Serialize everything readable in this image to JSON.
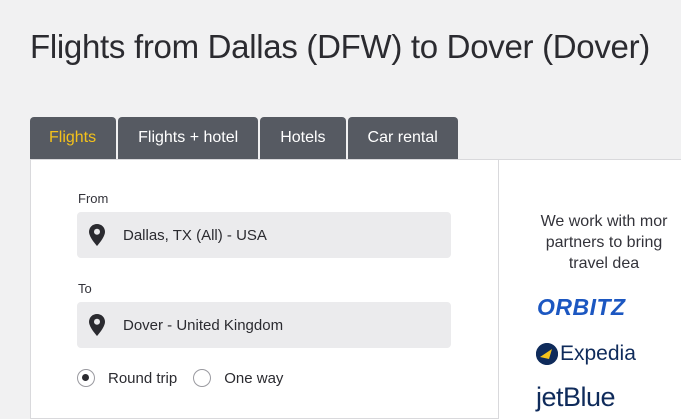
{
  "page": {
    "title": "Flights from Dallas (DFW) to Dover (Dover)"
  },
  "tabs": [
    {
      "label": "Flights",
      "active": true
    },
    {
      "label": "Flights + hotel",
      "active": false
    },
    {
      "label": "Hotels",
      "active": false
    },
    {
      "label": "Car rental",
      "active": false
    }
  ],
  "form": {
    "from_label": "From",
    "from_value": "Dallas, TX (All) - USA",
    "to_label": "To",
    "to_value": "Dover - United Kingdom",
    "trip_options": [
      {
        "label": "Round trip",
        "selected": true
      },
      {
        "label": "One way",
        "selected": false
      }
    ]
  },
  "partners": {
    "text_lines": [
      "We work with mor",
      "partners to bring",
      "travel dea"
    ],
    "logos": [
      "ORBITZ",
      "Expedia",
      "jetBlue"
    ]
  },
  "colors": {
    "tab_bg": "#565a62",
    "active_tab_text": "#f4c21b",
    "field_bg": "#ebebed",
    "orbitz_blue": "#1c57c1",
    "navy": "#0f2b5b"
  },
  "icons": {
    "location": "map-pin-icon"
  }
}
